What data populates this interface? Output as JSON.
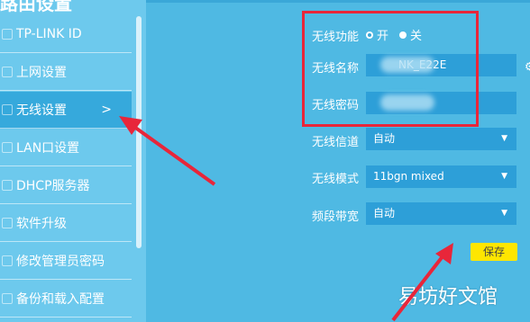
{
  "sidebar": {
    "title": "路由设置",
    "items": [
      {
        "label": "TP-LINK ID"
      },
      {
        "label": "上网设置"
      },
      {
        "label": "无线设置",
        "active": true,
        "chevron": ">"
      },
      {
        "label": "LAN口设置"
      },
      {
        "label": "DHCP服务器"
      },
      {
        "label": "软件升级"
      },
      {
        "label": "修改管理员密码"
      },
      {
        "label": "备份和载入配置"
      }
    ]
  },
  "wireless": {
    "function_label": "无线功能",
    "on_label": "开",
    "off_label": "关",
    "selected": "开",
    "ssid_label": "无线名称",
    "ssid_value": "NK_E22E",
    "password_label": "无线密码",
    "channel_label": "无线信道",
    "channel_value": "自动",
    "mode_label": "无线模式",
    "mode_value": "11bgn mixed",
    "bandwidth_label": "频段带宽",
    "bandwidth_value": "自动",
    "save_label": "保存"
  },
  "watermark": "易坊好文馆",
  "colors": {
    "page_bg": "#4fb9e3",
    "sidebar_bg": "#6dc9ed",
    "active_bg": "#36a9dc",
    "field_bg": "#2d9fd8",
    "save_bg": "#ffe600",
    "annotation_red": "#e8263a"
  }
}
